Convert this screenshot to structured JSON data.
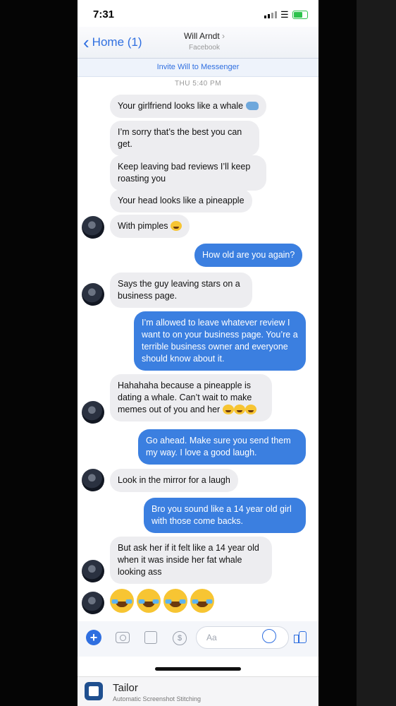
{
  "status": {
    "time": "7:31"
  },
  "nav": {
    "back_label": "Home (1)",
    "contact_name": "Will Arndt",
    "contact_sub": "Facebook"
  },
  "invite_label": "Invite Will to Messenger",
  "timestamp": "THU 5:40 PM",
  "messages": [
    {
      "dir": "in",
      "text": "Your girlfriend looks like a whale"
    },
    {
      "dir": "in",
      "text": "I’m sorry that’s the best you can get."
    },
    {
      "dir": "in",
      "text": "Keep leaving bad reviews I’ll keep roasting you"
    },
    {
      "dir": "in",
      "text": "Your head looks like a pineapple"
    },
    {
      "dir": "in",
      "text": "With pimples"
    },
    {
      "dir": "out",
      "text": "How old are you again?"
    },
    {
      "dir": "in",
      "text": "Says the guy leaving stars on a business page."
    },
    {
      "dir": "out",
      "text": "I’m allowed to leave whatever review I want to on your business page. You’re a terrible business owner and everyone should know about it."
    },
    {
      "dir": "in",
      "text": "Hahahaha because a pineapple is dating a whale. Can’t wait to make memes out of you and her"
    },
    {
      "dir": "out",
      "text": "Go ahead. Make sure you send them my way. I love a good laugh."
    },
    {
      "dir": "in",
      "text": "Look in the mirror for a laugh"
    },
    {
      "dir": "out",
      "text": "Bro you sound like a 14 year old girl with those come backs."
    },
    {
      "dir": "in",
      "text": "But ask her if it felt like a 14 year old when it was inside her fat whale looking ass"
    }
  ],
  "composer": {
    "placeholder": "Aa"
  },
  "tailor": {
    "name": "Tailor",
    "subtitle": "Automatic Screenshot Stitching"
  },
  "colors": {
    "accent": "#2f6fe0",
    "outgoing_bubble": "#3b7fe0",
    "incoming_bubble": "#ededf0"
  }
}
